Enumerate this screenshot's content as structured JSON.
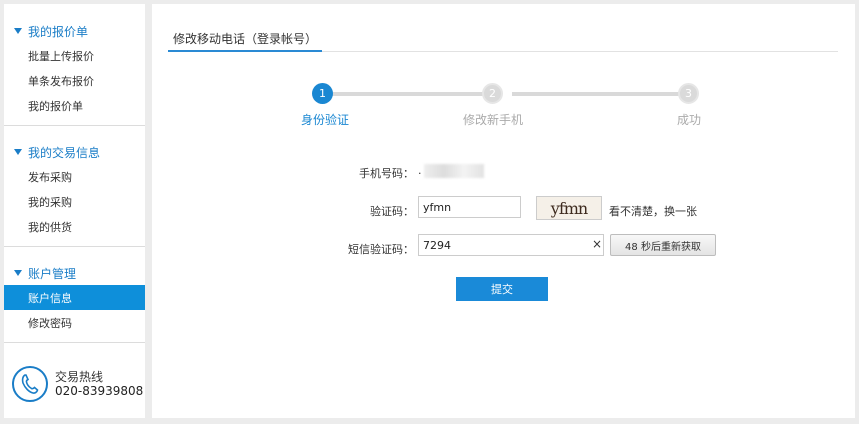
{
  "sidebar": {
    "groups": [
      {
        "title": "我的报价单",
        "items": [
          "批量上传报价",
          "单条发布报价",
          "我的报价单"
        ]
      },
      {
        "title": "我的交易信息",
        "items": [
          "发布采购",
          "我的采购",
          "我的供货"
        ]
      },
      {
        "title": "账户管理",
        "items": [
          "账户信息",
          "修改密码"
        ]
      }
    ],
    "active_item": "账户信息",
    "hotline": {
      "title": "交易热线",
      "number": "020-83939808"
    }
  },
  "main": {
    "tab_label": "修改移动电话（登录帐号）",
    "steps": [
      {
        "number": "1",
        "label": "身份验证",
        "active": true
      },
      {
        "number": "2",
        "label": "修改新手机",
        "active": false
      },
      {
        "number": "3",
        "label": "成功",
        "active": false
      }
    ],
    "form": {
      "phone_label": "手机号码：",
      "phone_value": ".",
      "captcha_label": "验证码：",
      "captcha_value": "yfmn",
      "captcha_image_text": "yfmn",
      "captcha_refresh": "看不清楚，换一张",
      "sms_label": "短信验证码：",
      "sms_value": "7294",
      "clear_symbol": "×",
      "resend_label": "48 秒后重新获取",
      "submit_label": "提交"
    }
  },
  "colors": {
    "accent": "#1a87d2",
    "active_nav_bg": "#0e8fda",
    "inactive_step": "#dadada"
  }
}
